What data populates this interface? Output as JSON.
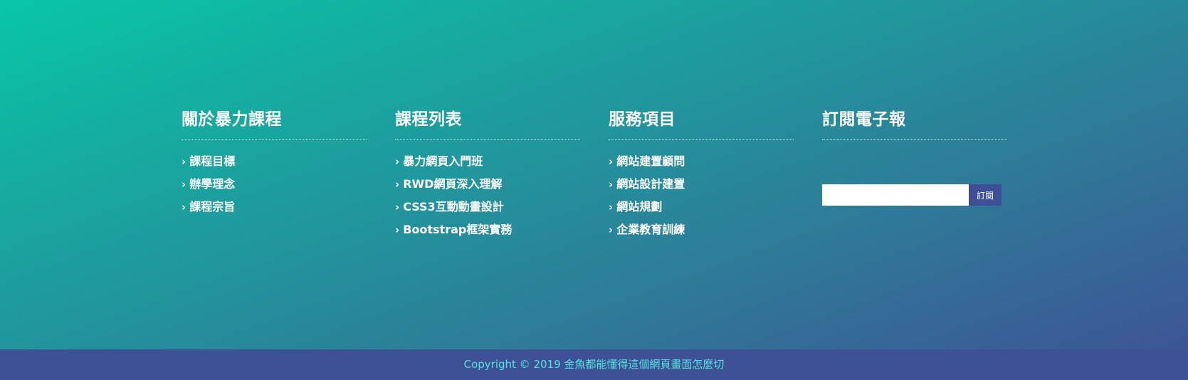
{
  "columns": [
    {
      "title": "關於暴力課程",
      "links": [
        "課程目標",
        "辦學理念",
        "課程宗旨"
      ]
    },
    {
      "title": "課程列表",
      "links": [
        "暴力網頁入門班",
        "RWD網頁深入理解",
        "CSS3互動動畫設計",
        "Bootstrap框架實務"
      ]
    },
    {
      "title": "服務項目",
      "links": [
        "網站建置顧問",
        "網站設計建置",
        "網站規劃",
        "企業教育訓練"
      ]
    }
  ],
  "newsletter": {
    "title": "訂閱電子報",
    "input_value": "",
    "button_label": "訂閱"
  },
  "footer": {
    "copyright": "Copyright © 2019 金魚都能懂得這個網頁畫面怎麼切"
  },
  "icons": {
    "chevron": "chevron-right-icon"
  },
  "colors": {
    "gradient_start": "#08c6a6",
    "gradient_end": "#3d5596",
    "copyright_bar": "#3e5195",
    "copyright_text": "#52e5e0",
    "button_bg": "#3f4f97"
  }
}
